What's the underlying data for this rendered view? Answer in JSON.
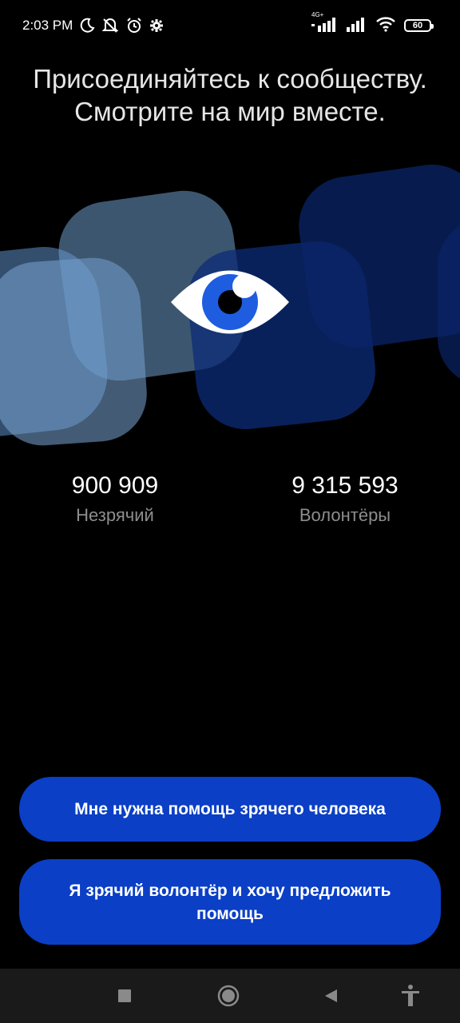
{
  "status_bar": {
    "time": "2:03 PM",
    "network_label": "4G+",
    "battery": "60",
    "icons": [
      "moon-icon",
      "mute-icon",
      "alarm-icon",
      "gear-icon",
      "signal-icon",
      "signal-icon",
      "wifi-icon",
      "battery-icon"
    ]
  },
  "headline": {
    "line1": "Присоединяйтесь к сообществу.",
    "line2": "Смотрите на мир вместе."
  },
  "hero": {
    "icon": "eye-icon"
  },
  "stats": [
    {
      "value": "900 909",
      "label": "Незрячий"
    },
    {
      "value": "9 315 593",
      "label": "Волонтёры"
    }
  ],
  "buttons": {
    "need_help": "Мне нужна помощь зрячего человека",
    "volunteer": "Я зрячий волонтёр и хочу предложить помощь"
  },
  "nav_bar": {
    "items": [
      "recents-square-icon",
      "home-circle-icon",
      "back-triangle-icon",
      "accessibility-icon"
    ]
  },
  "colors": {
    "background": "#000000",
    "button": "#0a3fc6",
    "label_gray": "#8d8d8d",
    "eye_iris": "#1f5de0"
  }
}
